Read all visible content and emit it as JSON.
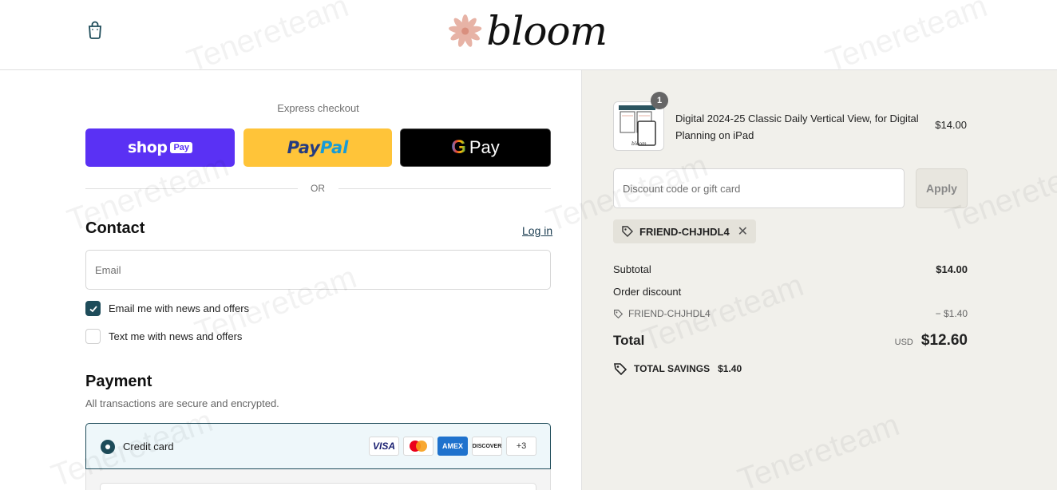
{
  "header": {
    "logo_text": "bloom",
    "logo_flower_color": "#e7b3a6"
  },
  "express": {
    "title": "Express checkout",
    "shop_word": "shop",
    "shop_chip": "Pay",
    "paypal_part1": "Pay",
    "paypal_part2": "Pal",
    "gpay_g": "G",
    "gpay_word": "Pay",
    "or": "OR",
    "colors": {
      "shop": "#5a31f4",
      "paypal": "#ffc439",
      "gpay": "#000000"
    }
  },
  "contact": {
    "title": "Contact",
    "login_link": "Log in",
    "email_placeholder": "Email",
    "news_email": {
      "label": "Email me with news and offers",
      "checked": true
    },
    "news_text": {
      "label": "Text me with news and offers",
      "checked": false
    }
  },
  "payment": {
    "title": "Payment",
    "subtitle": "All transactions are secure and encrypted.",
    "credit_card_label": "Credit card",
    "card_brands": [
      "VISA",
      "mastercard",
      "AMEX",
      "DISCOVER"
    ],
    "more_cards": "+3"
  },
  "order": {
    "item": {
      "quantity": "1",
      "name": "Digital 2024-25 Classic Daily Vertical View, for Digital Planning on iPad",
      "price": "$14.00"
    },
    "discount_placeholder": "Discount code or gift card",
    "apply_label": "Apply",
    "applied_code": "FRIEND-CHJHDL4",
    "subtotal_label": "Subtotal",
    "subtotal_value": "$14.00",
    "order_discount_label": "Order discount",
    "discount_code_label": "FRIEND-CHJHDL4",
    "discount_value": "− $1.40",
    "total_label": "Total",
    "total_currency": "USD",
    "total_value": "$12.60",
    "savings_label": "TOTAL SAVINGS",
    "savings_value": "$1.40"
  },
  "watermark": "Tenereteam"
}
